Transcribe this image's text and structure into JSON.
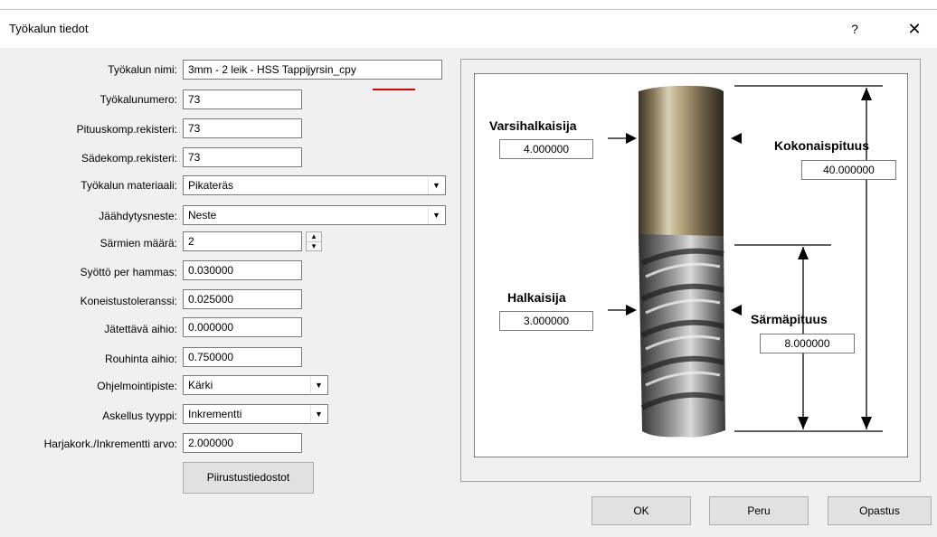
{
  "window": {
    "title": "Työkalun tiedot",
    "help": "?",
    "close": "✕"
  },
  "form": {
    "name_label": "Työkalun nimi:",
    "name_value": "3mm  -  2 leik - HSS Tappijyrsin_cpy",
    "number_label": "Työkalunumero:",
    "number_value": "73",
    "lengthcomp_label": "Pituuskomp.rekisteri:",
    "lengthcomp_value": "73",
    "radiuscomp_label": "Sädekomp.rekisteri:",
    "radiuscomp_value": "73",
    "material_label": "Työkalun materiaali:",
    "material_value": "Pikateräs",
    "coolant_label": "Jäähdytysneste:",
    "coolant_value": "Neste",
    "flutes_label": "Särmien määrä:",
    "flutes_value": "2",
    "feed_label": "Syöttö per hammas:",
    "feed_value": "0.030000",
    "tolerance_label": "Koneistustoleranssi:",
    "tolerance_value": "0.025000",
    "stock_label": "Jätettävä aihio:",
    "stock_value": "0.000000",
    "rough_label": "Rouhinta aihio:",
    "rough_value": "0.750000",
    "origin_label": "Ohjelmointipiste:",
    "origin_value": "Kärki",
    "steptype_label": "Askellus tyyppi:",
    "steptype_value": "Inkrementti",
    "stepvalue_label": "Harjakork./Inkrementti arvo:",
    "stepvalue_value": "2.000000",
    "drawings_button": "Piirustustiedostot"
  },
  "diagram": {
    "shank_label": "Varsihalkaisija",
    "shank_value": "4.000000",
    "total_label": "Kokonaispituus",
    "total_value": "40.000000",
    "diameter_label": "Halkaisija",
    "diameter_value": "3.000000",
    "flute_label": "Särmäpituus",
    "flute_value": "8.000000"
  },
  "buttons": {
    "ok": "OK",
    "cancel": "Peru",
    "help": "Opastus"
  }
}
